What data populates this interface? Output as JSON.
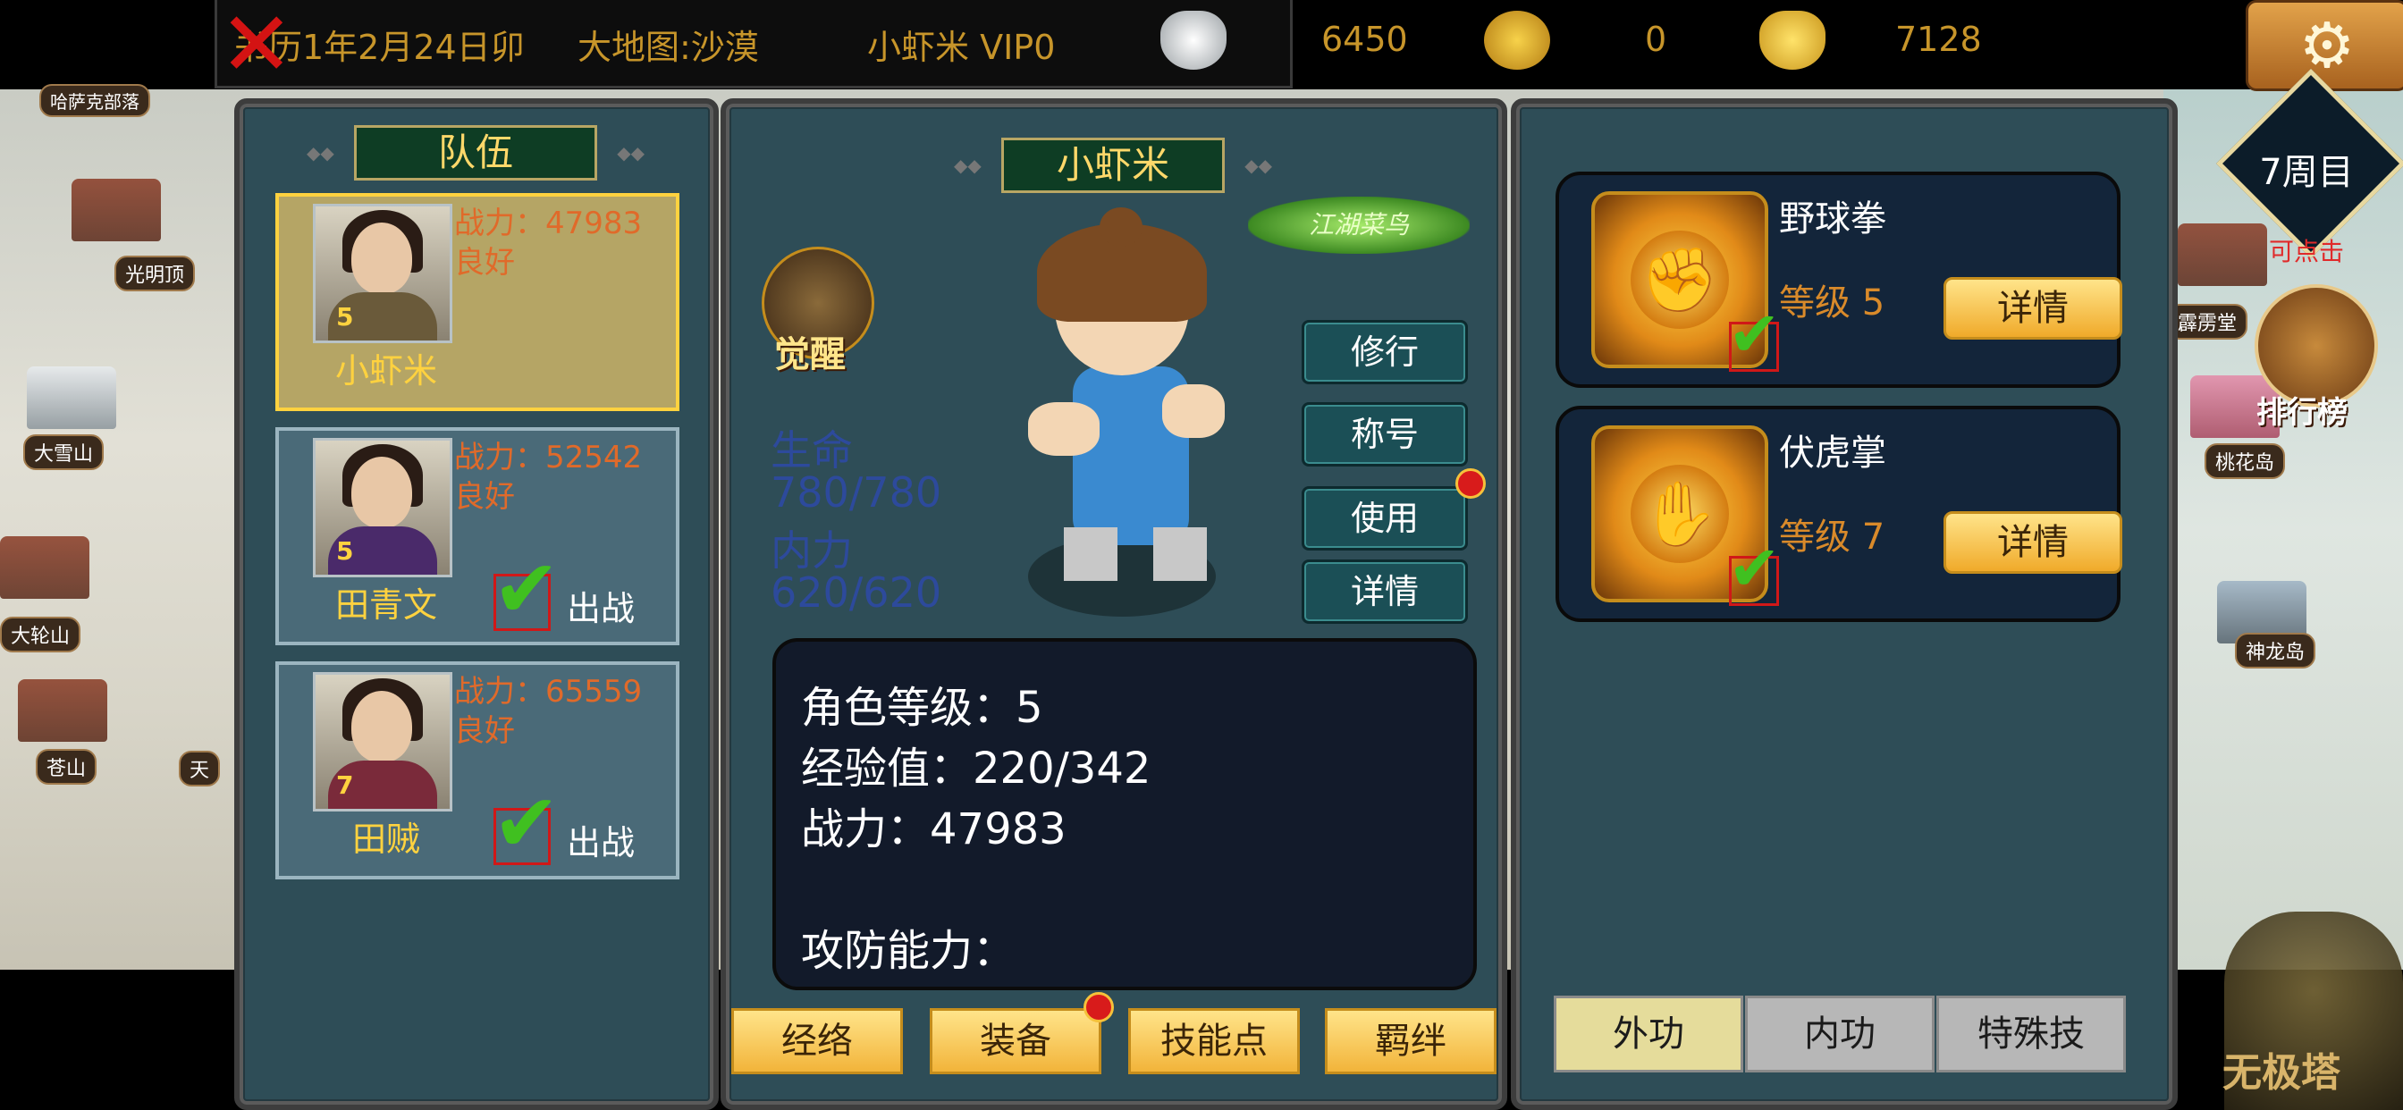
{
  "topbar": {
    "calendar": "书历1年2月24日卯",
    "map": "大地图:沙漠",
    "player": "小虾米 VIP0",
    "silver": "6450",
    "coins": "0",
    "gold": "7128"
  },
  "map_labels": {
    "hasake": "哈萨克部落",
    "guangming": "光明顶",
    "daxueshan": "大雪山",
    "dalunshan": "大轮山",
    "cangshan": "苍山",
    "tian": "天",
    "pili": "霹雳堂",
    "taohua": "桃花岛",
    "shenlong": "神龙岛"
  },
  "hud": {
    "week": "7周目",
    "click_hint": "可点击",
    "rank": "排行榜",
    "tower": "无极塔"
  },
  "team": {
    "title": "队伍",
    "members": [
      {
        "name": "小虾米",
        "level": "5",
        "power": "战力：47983",
        "status": "良好"
      },
      {
        "name": "田青文",
        "level": "5",
        "power": "战力：52542",
        "status": "良好",
        "deploy": "出战"
      },
      {
        "name": "田贼",
        "level": "7",
        "power": "战力：65559",
        "status": "良好",
        "deploy": "出战"
      }
    ]
  },
  "character": {
    "name": "小虾米",
    "awaken": "觉醒",
    "faction_badge": "江湖菜鸟",
    "hp_label": "生命",
    "hp_value": "780/780",
    "mp_label": "内力",
    "mp_value": "620/620",
    "actions": [
      "修行",
      "称号",
      "使用",
      "详情"
    ],
    "info": {
      "level": "角色等级：5",
      "exp": "经验值：220/342",
      "power": "战力：47983",
      "attack": "攻防能力："
    },
    "bottom_buttons": [
      "经络",
      "装备",
      "技能点",
      "羁绊"
    ]
  },
  "skills": {
    "items": [
      {
        "name": "野球拳",
        "level": "等级 5",
        "detail": "详情"
      },
      {
        "name": "伏虎掌",
        "level": "等级 7",
        "detail": "详情"
      }
    ],
    "tabs": [
      "外功",
      "内功",
      "特殊技"
    ]
  }
}
